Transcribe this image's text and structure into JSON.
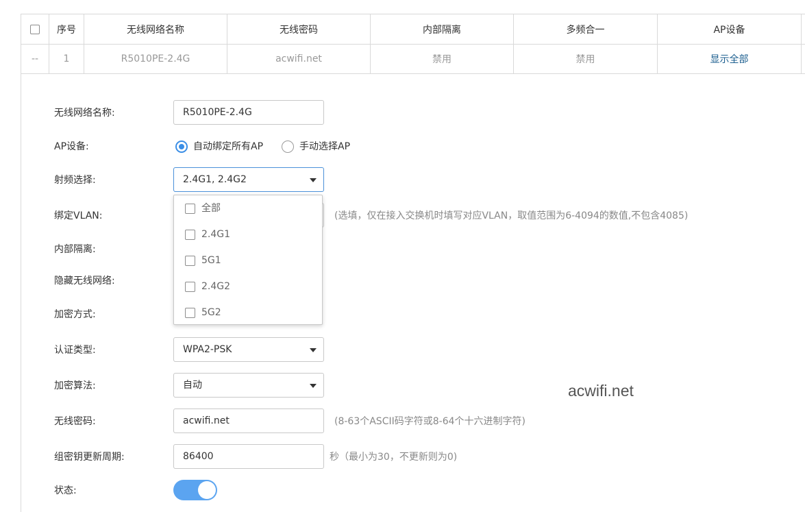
{
  "table": {
    "headers": [
      "序号",
      "无线网络名称",
      "无线密码",
      "内部隔离",
      "多频合一",
      "AP设备"
    ],
    "row": {
      "dash": "--",
      "index": "1",
      "ssid": "R5010PE-2.4G",
      "password": "acwifi.net",
      "isolation": "禁用",
      "multiband": "禁用",
      "ap_link": "显示全部"
    }
  },
  "form": {
    "ssid_label": "无线网络名称:",
    "ssid_value": "R5010PE-2.4G",
    "ap_label": "AP设备:",
    "ap_option_auto": "自动绑定所有AP",
    "ap_option_manual": "手动选择AP",
    "radio_label": "射频选择:",
    "radio_value": "2.4G1, 2.4G2",
    "radio_options": [
      "全部",
      "2.4G1",
      "5G1",
      "2.4G2",
      "5G2"
    ],
    "vlan_label": "绑定VLAN:",
    "vlan_hint": "(选填，仅在接入交换机时填写对应VLAN，取值范围为6-4094的数值,不包含4085)",
    "isolation_label": "内部隔离:",
    "hide_label": "隐藏无线网络:",
    "encryption_label": "加密方式:",
    "auth_label": "认证类型:",
    "auth_value": "WPA2-PSK",
    "algo_label": "加密算法:",
    "algo_value": "自动",
    "password_label": "无线密码:",
    "password_value": "acwifi.net",
    "password_hint": "(8-63个ASCII码字符或8-64个十六进制字符)",
    "rekey_label": "组密钥更新周期:",
    "rekey_value": "86400",
    "rekey_hint": "秒（最小为30，不更新则为0)",
    "status_label": "状态:",
    "status_on": true
  },
  "watermark": "acwifi.net",
  "colors": {
    "accent": "#3a8ee6",
    "toggle": "#5ba4f0",
    "link": "#1b5e8f"
  }
}
